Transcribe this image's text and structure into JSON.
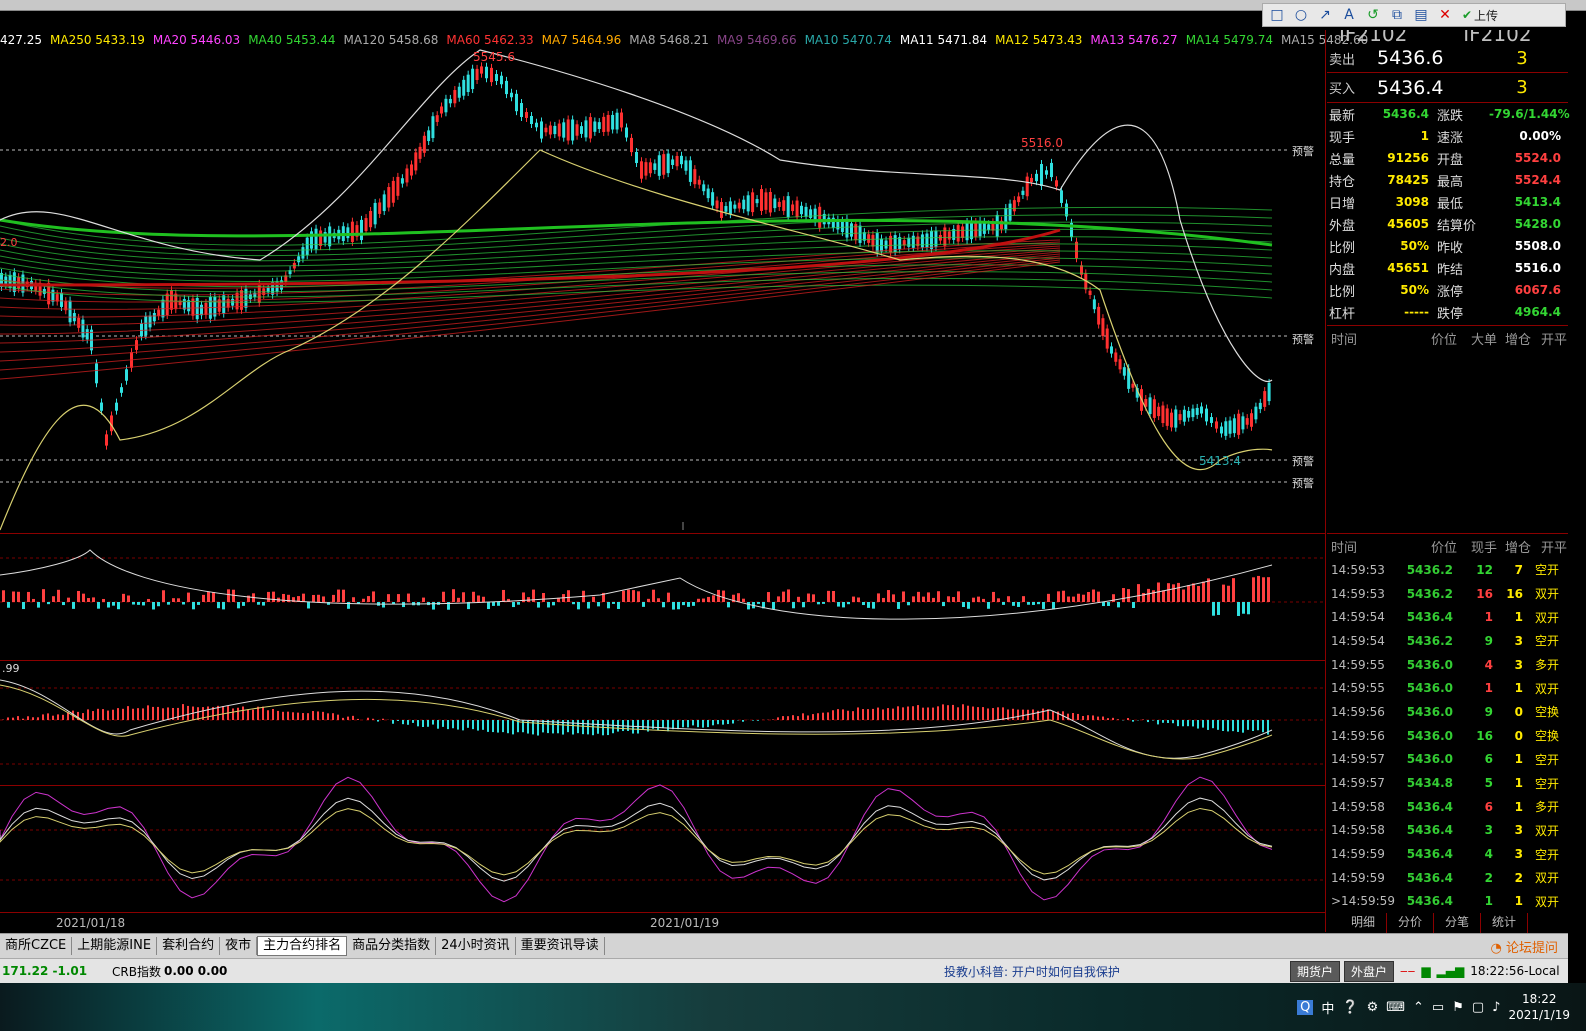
{
  "toolbar": {
    "upload_label": "上传"
  },
  "ma_legend": [
    {
      "text": "427.25",
      "color": "#ffffff"
    },
    {
      "text": "MA250 5433.19",
      "color": "#ffea00"
    },
    {
      "text": "MA20 5446.03",
      "color": "#ff44ff"
    },
    {
      "text": "MA40 5453.44",
      "color": "#33d633"
    },
    {
      "text": "MA120 5458.68",
      "color": "#aaaaaa"
    },
    {
      "text": "MA60 5462.33",
      "color": "#ff3333"
    },
    {
      "text": "MA7 5464.96",
      "color": "#ffaa00"
    },
    {
      "text": "MA8 5468.21",
      "color": "#aaaaaa"
    },
    {
      "text": "MA9 5469.66",
      "color": "#884488"
    },
    {
      "text": "MA10 5470.74",
      "color": "#2aa8a8"
    },
    {
      "text": "MA11 5471.84",
      "color": "#ffffff"
    },
    {
      "text": "MA12 5473.43",
      "color": "#ffea00"
    },
    {
      "text": "MA13 5476.27",
      "color": "#ff44ff"
    },
    {
      "text": "MA14 5479.74",
      "color": "#33d633"
    },
    {
      "text": "MA15 5482.60",
      "color": "#aaaaaa"
    }
  ],
  "chart_labels": {
    "high_label": "5545.6",
    "mid_high_label": "5516.0",
    "low_label": "5413.4",
    "left_price": "2.0",
    "alert": "预警",
    "macd_value": ".99"
  },
  "chart_data": {
    "type": "line",
    "x_axis_labels": [
      "2021/01/18",
      "2021/01/19"
    ],
    "annotations": [
      "5545.6",
      "5516.0",
      "5413.4"
    ]
  },
  "quote": {
    "contract": "IF2102",
    "sell_label": "卖出",
    "sell_price": "5436.6",
    "sell_qty": "3",
    "buy_label": "买入",
    "buy_price": "5436.4",
    "buy_qty": "3",
    "rows": [
      {
        "k": "最新",
        "v": "5436.4",
        "vc": "green",
        "k2": "涨跌",
        "v2": "-79.6/1.44%",
        "v2c": "green"
      },
      {
        "k": "现手",
        "v": "1",
        "vc": "yellow",
        "k2": "速涨",
        "v2": "0.00%",
        "v2c": "white"
      },
      {
        "k": "总量",
        "v": "91256",
        "vc": "yellow",
        "k2": "开盘",
        "v2": "5524.0",
        "v2c": "red"
      },
      {
        "k": "持仓",
        "v": "78425",
        "vc": "yellow",
        "k2": "最高",
        "v2": "5524.4",
        "v2c": "red"
      },
      {
        "k": "日增",
        "v": "3098",
        "vc": "yellow",
        "k2": "最低",
        "v2": "5413.4",
        "v2c": "green"
      },
      {
        "k": "外盘",
        "v": "45605",
        "vc": "yellow",
        "k2": "结算价",
        "v2": "5428.0",
        "v2c": "green"
      },
      {
        "k": "比例",
        "v": "50%",
        "vc": "yellow",
        "k2": "昨收",
        "v2": "5508.0",
        "v2c": "white"
      },
      {
        "k": "内盘",
        "v": "45651",
        "vc": "yellow",
        "k2": "昨结",
        "v2": "5516.0",
        "v2c": "white"
      },
      {
        "k": "比例",
        "v": "50%",
        "vc": "yellow",
        "k2": "涨停",
        "v2": "6067.6",
        "v2c": "red"
      },
      {
        "k": "杠杆",
        "v": "-----",
        "vc": "yellow",
        "k2": "跌停",
        "v2": "4964.4",
        "v2c": "green"
      }
    ]
  },
  "big_orders_header": [
    "时间",
    "价位",
    "大单",
    "增仓",
    "开平"
  ],
  "ticks_header": [
    "时间",
    "价位",
    "现手",
    "增仓",
    "开平"
  ],
  "ticks": [
    {
      "t": "14:59:53",
      "p": "5436.2",
      "q": "12",
      "qc": "green",
      "o": "7",
      "ty": "空开"
    },
    {
      "t": "14:59:53",
      "p": "5436.2",
      "q": "16",
      "qc": "red",
      "o": "16",
      "ty": "双开"
    },
    {
      "t": "14:59:54",
      "p": "5436.4",
      "q": "1",
      "qc": "red",
      "o": "1",
      "ty": "双开"
    },
    {
      "t": "14:59:54",
      "p": "5436.2",
      "q": "9",
      "qc": "green",
      "o": "3",
      "ty": "空开"
    },
    {
      "t": "14:59:55",
      "p": "5436.0",
      "q": "4",
      "qc": "red",
      "o": "3",
      "ty": "多开"
    },
    {
      "t": "14:59:55",
      "p": "5436.0",
      "q": "1",
      "qc": "red",
      "o": "1",
      "ty": "双开"
    },
    {
      "t": "14:59:56",
      "p": "5436.0",
      "q": "9",
      "qc": "green",
      "o": "0",
      "ty": "空换"
    },
    {
      "t": "14:59:56",
      "p": "5436.0",
      "q": "16",
      "qc": "green",
      "o": "0",
      "ty": "空换"
    },
    {
      "t": "14:59:57",
      "p": "5436.0",
      "q": "6",
      "qc": "green",
      "o": "1",
      "ty": "空开"
    },
    {
      "t": "14:59:57",
      "p": "5434.8",
      "q": "5",
      "qc": "green",
      "o": "1",
      "ty": "空开"
    },
    {
      "t": "14:59:58",
      "p": "5436.4",
      "q": "6",
      "qc": "red",
      "o": "1",
      "ty": "多开"
    },
    {
      "t": "14:59:58",
      "p": "5436.4",
      "q": "3",
      "qc": "green",
      "o": "3",
      "ty": "双开"
    },
    {
      "t": "14:59:59",
      "p": "5436.4",
      "q": "4",
      "qc": "green",
      "o": "3",
      "ty": "空开"
    },
    {
      "t": "14:59:59",
      "p": "5436.4",
      "q": "2",
      "qc": "green",
      "o": "2",
      "ty": "双开"
    },
    {
      "t": ">14:59:59",
      "p": "5436.4",
      "q": "1",
      "qc": "green",
      "o": "1",
      "ty": "双开"
    }
  ],
  "right_tabs": [
    "明细",
    "分价",
    "分笔",
    "统计"
  ],
  "tabs": [
    "商所CZCE",
    "上期能源INE",
    "套利合约",
    "夜市",
    "主力合约排名",
    "商品分类指数",
    "24小时资讯",
    "重要资讯导读"
  ],
  "active_tab": "主力合约排名",
  "forum_label": "论坛提问",
  "status": {
    "index_value": "171.22 -1.01",
    "crb_label": "CRB指数",
    "crb_value": "0.00 0.00",
    "tip": "投教小科普: 开户时如何自我保护",
    "btn_futures": "期货户",
    "btn_outer": "外盘户",
    "time": "18:22:56-Local"
  },
  "taskbar": {
    "ime": "中",
    "time": "18:22",
    "date": "2021/1/19"
  }
}
